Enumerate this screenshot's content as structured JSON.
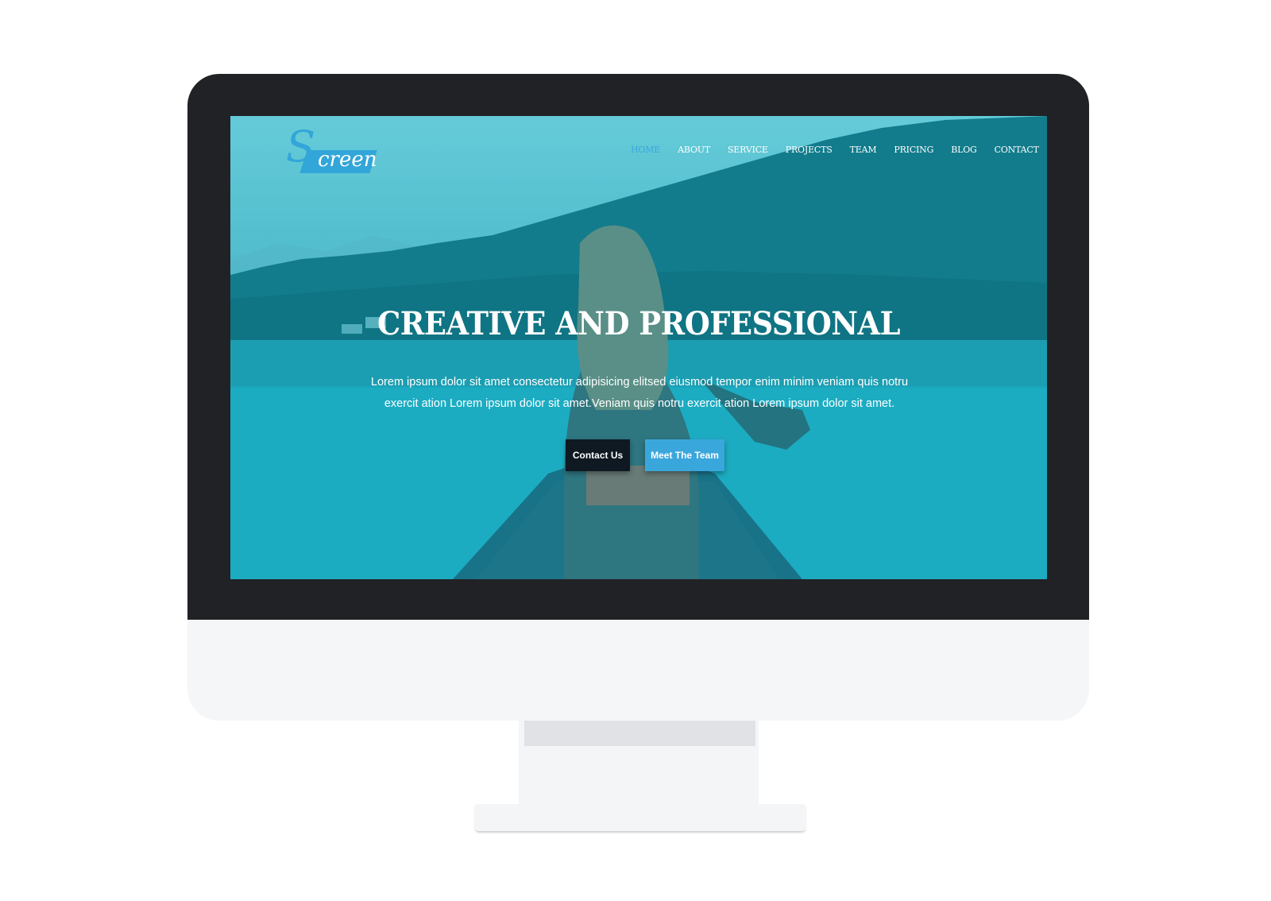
{
  "logo": {
    "first_letter": "S",
    "rest": "creen"
  },
  "nav": {
    "items": [
      {
        "label": "HOME",
        "active": true
      },
      {
        "label": "ABOUT",
        "active": false
      },
      {
        "label": "SERVICE",
        "active": false
      },
      {
        "label": "PROJECTS",
        "active": false
      },
      {
        "label": "TEAM",
        "active": false
      },
      {
        "label": "PRICING",
        "active": false
      },
      {
        "label": "BLOG",
        "active": false
      },
      {
        "label": "CONTACT",
        "active": false
      }
    ]
  },
  "hero": {
    "title": "CREATIVE AND PROFESSIONAL",
    "text": "Lorem ipsum dolor sit amet consectetur adipisicing elitsed eiusmod tempor enim minim veniam quis notru exercit ation Lorem ipsum dolor sit amet.Veniam quis notru exercit ation Lorem ipsum dolor sit amet.",
    "primary_button": "Contact Us",
    "secondary_button": "Meet The Team"
  },
  "colors": {
    "accent": "#3aa7dc",
    "dark_button": "#0f1922",
    "bezel": "#212226",
    "chin": "#f5f6f8"
  }
}
